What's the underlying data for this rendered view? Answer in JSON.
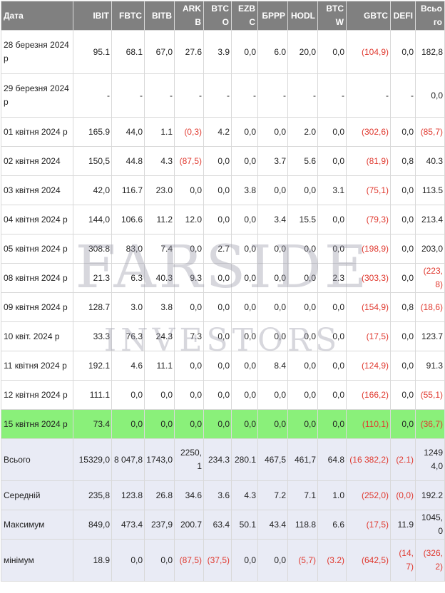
{
  "headers": [
    "Дата",
    "IBIT",
    "FBTC",
    "BITB",
    "ARKB",
    "BTCO",
    "EZBC",
    "БРРР",
    "HODL",
    "BTCW",
    "GBTC",
    "DEFI",
    "Всього"
  ],
  "rows": [
    {
      "date": "28 березня 2024 р",
      "cells": [
        "95.1",
        "68.1",
        "67,0",
        "27.6",
        "3.9",
        "0,0",
        "6.0",
        "20,0",
        "0,0",
        "(104,9)",
        "0,0",
        "182,8"
      ]
    },
    {
      "date": "29 березня 2024 р",
      "cells": [
        "-",
        "-",
        "-",
        "-",
        "-",
        "-",
        "-",
        "-",
        "-",
        "-",
        "-",
        "0,0"
      ]
    },
    {
      "date": "01 квітня 2024 р",
      "cells": [
        "165.9",
        "44,0",
        "1.1",
        "(0,3)",
        "4.2",
        "0,0",
        "0,0",
        "2.0",
        "0,0",
        "(302,6)",
        "0,0",
        "(85,7)"
      ]
    },
    {
      "date": "02 квітня 2024",
      "cells": [
        "150,5",
        "44.8",
        "4.3",
        "(87,5)",
        "0,0",
        "0,0",
        "3.7",
        "5.6",
        "0,0",
        "(81,9)",
        "0,8",
        "40.3"
      ]
    },
    {
      "date": "03 квітня 2024",
      "cells": [
        "42,0",
        "116.7",
        "23.0",
        "0,0",
        "0,0",
        "3.8",
        "0,0",
        "0,0",
        "3.1",
        "(75,1)",
        "0,0",
        "113.5"
      ]
    },
    {
      "date": "04 квітня 2024 р",
      "cells": [
        "144,0",
        "106.6",
        "11.2",
        "12.0",
        "0,0",
        "0,0",
        "3.4",
        "15.5",
        "0,0",
        "(79,3)",
        "0,0",
        "213.4"
      ]
    },
    {
      "date": "05 квітня 2024 р",
      "cells": [
        "308.8",
        "83,0",
        "7.4",
        "0,0",
        "2.7",
        "0,0",
        "0,0",
        "0,0",
        "0,0",
        "(198,9)",
        "0,0",
        "203,0"
      ]
    },
    {
      "date": "08 квітня 2024 р",
      "cells": [
        "21.3",
        "6.3",
        "40.3",
        "9.3",
        "0,0",
        "0,0",
        "0,0",
        "0,0",
        "2.3",
        "(303,3)",
        "0,0",
        "(223,8)"
      ]
    },
    {
      "date": "09 квітня 2024 р",
      "cells": [
        "128.7",
        "3.0",
        "3.8",
        "0,0",
        "0,0",
        "0,0",
        "0,0",
        "0,0",
        "0,0",
        "(154,9)",
        "0,8",
        "(18,6)"
      ]
    },
    {
      "date": "10 квіт. 2024 р",
      "cells": [
        "33.3",
        "76.3",
        "24.3",
        "7.3",
        "0,0",
        "0,0",
        "0,0",
        "0,0",
        "0,0",
        "(17,5)",
        "0,0",
        "123.7"
      ]
    },
    {
      "date": "11 квітня 2024 р",
      "cells": [
        "192.1",
        "4.6",
        "11.1",
        "0,0",
        "0,0",
        "0,0",
        "8.4",
        "0,0",
        "0,0",
        "(124,9)",
        "0,0",
        "91.3"
      ]
    },
    {
      "date": "12 квітня 2024 р",
      "cells": [
        "111.1",
        "0,0",
        "0,0",
        "0,0",
        "0,0",
        "0,0",
        "0,0",
        "0,0",
        "0,0",
        "(166,2)",
        "0,0",
        "(55,1)"
      ]
    },
    {
      "date": "15 квітня 2024 р",
      "cells": [
        "73.4",
        "0,0",
        "0,0",
        "0,0",
        "0,0",
        "0,0",
        "0,0",
        "0,0",
        "0,0",
        "(110,1)",
        "0,0",
        "(36,7)"
      ]
    }
  ],
  "summary": [
    {
      "label": "Всього",
      "cells": [
        "15329,0",
        "8 047,8",
        "1743,0",
        "2250,1",
        "234.3",
        "280.1",
        "467,5",
        "461,7",
        "64.8",
        "(16 382,2)",
        "(2.1)",
        "12494,0"
      ]
    },
    {
      "label": "Середній",
      "cells": [
        "235,8",
        "123.8",
        "26.8",
        "34.6",
        "3.6",
        "4.3",
        "7.2",
        "7.1",
        "1.0",
        "(252,0)",
        "(0,0)",
        "192.2"
      ]
    },
    {
      "label": "Максимум",
      "cells": [
        "849,0",
        "473.4",
        "237,9",
        "200.7",
        "63.4",
        "50.1",
        "43.4",
        "118.8",
        "6.6",
        "(17,5)",
        "11.9",
        "1045,0"
      ]
    },
    {
      "label": "мінімум",
      "cells": [
        "18.9",
        "0,0",
        "0,0",
        "(87,5)",
        "(37,5)",
        "0,0",
        "0,0",
        "(5,7)",
        "(3.2)",
        "(642,5)",
        "(14,7)",
        "(326,2)"
      ]
    }
  ],
  "watermark": {
    "main": "FARSIDE",
    "sub": "INVESTORS"
  },
  "colors": {
    "header_bg": "#808080",
    "negative": "#e0392f",
    "highlight_row": "#8af07a",
    "summary_bg": "#e9ebf5"
  }
}
